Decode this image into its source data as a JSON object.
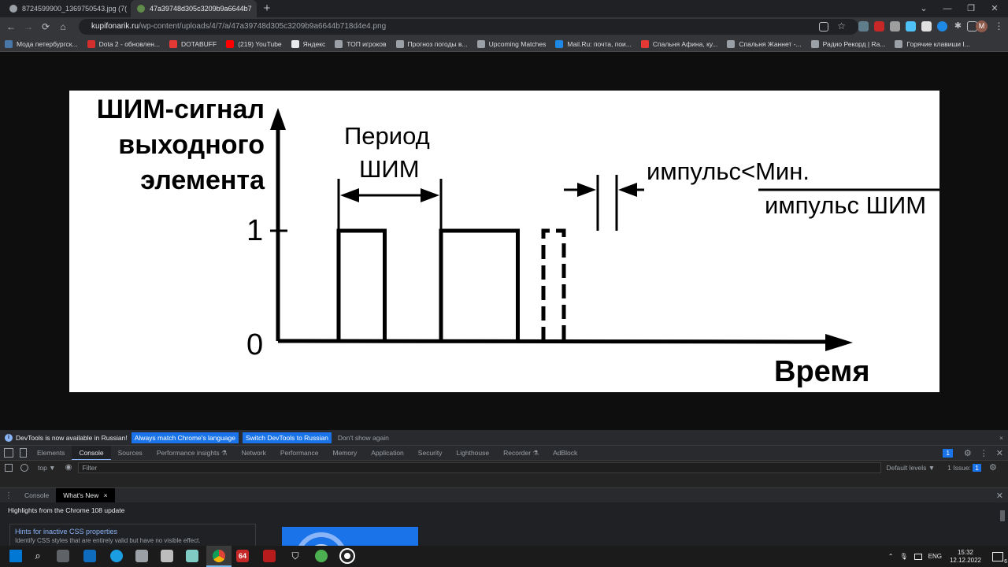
{
  "browser": {
    "tabs": [
      {
        "title": "8724599900_1369750543.jpg (7(",
        "close": "×",
        "active": false
      },
      {
        "title": "47a39748d305c3209b9a6644b7",
        "close": "×",
        "active": true
      }
    ],
    "new_tab": "+",
    "window_controls": [
      "⌄",
      "—",
      "❐",
      "✕"
    ],
    "nav": {
      "back": "←",
      "forward": "→",
      "reload": "⟳",
      "home": "⌂"
    },
    "url": {
      "host": "kupifonarik.ru",
      "path": "/wp-content/uploads/4/7/a/47a39748d305c3209b9a6644b718d4e4.png"
    },
    "profile_initial": "M",
    "bookmarks": [
      {
        "label": "Мода петербургск...",
        "color": "#4a76a8"
      },
      {
        "label": "Dota 2 - обновлен...",
        "color": "#d32f2f"
      },
      {
        "label": "DOTABUFF",
        "color": "#e53935"
      },
      {
        "label": "(219) YouTube",
        "color": "#ff0000"
      },
      {
        "label": "Яндекс",
        "color": "#e8eaed"
      },
      {
        "label": "ТОП игроков",
        "color": "#9aa0a6"
      },
      {
        "label": "Прогноз погоды в...",
        "color": "#9aa0a6"
      },
      {
        "label": "Upcoming Matches",
        "color": "#9aa0a6"
      },
      {
        "label": "Mail.Ru: почта, пои...",
        "color": "#1e88e5"
      },
      {
        "label": "Спальня Афина, ку...",
        "color": "#e53935"
      },
      {
        "label": "Спальня Жаннет -...",
        "color": "#9aa0a6"
      },
      {
        "label": "Радио Рекорд | Ra...",
        "color": "#9aa0a6"
      },
      {
        "label": "Горячие клавиши I...",
        "color": "#9aa0a6"
      }
    ]
  },
  "figure": {
    "y_label_lines": [
      "ШИМ-сигнал",
      "выходного",
      "элемента"
    ],
    "x_label": "Время",
    "tick_one": "1",
    "tick_zero": "0",
    "period_label_lines": [
      "Период",
      "ШИМ"
    ],
    "pulse_note_lines": [
      "импульс<Мин.",
      "импульс ШИМ"
    ],
    "pulses": [
      {
        "start": 1.0,
        "end": 1.45,
        "style": "solid"
      },
      {
        "start": 2.0,
        "end": 2.75,
        "style": "solid"
      },
      {
        "start": 3.0,
        "end": 3.2,
        "style": "dashed"
      }
    ],
    "period_bracket": [
      1.0,
      2.0
    ]
  },
  "devtools": {
    "infobar": {
      "message": "DevTools is now available in Russian!",
      "btn_match": "Always match Chrome's language",
      "btn_switch": "Switch DevTools to Russian",
      "dont_show": "Don't show again",
      "close": "×"
    },
    "tabs": [
      "Elements",
      "Console",
      "Sources",
      "Performance insights ⚗",
      "Network",
      "Performance",
      "Memory",
      "Application",
      "Security",
      "Lighthouse",
      "Recorder ⚗",
      "AdBlock"
    ],
    "active_tab": "Console",
    "messages_badge": "1",
    "console": {
      "context": "top ▼",
      "filter_placeholder": "Filter",
      "levels": "Default levels ▼",
      "issues": "1 Issue: ",
      "issues_count": "1"
    },
    "drawer_tabs": [
      "Console",
      "What's New"
    ],
    "drawer_active": "What's New",
    "drawer_close": "×",
    "whats_new": {
      "title": "Highlights from the Chrome 108 update",
      "hint_title": "Hints for inactive CSS properties",
      "hint_sub": "Identify CSS styles that are entirely valid but have no visible effect."
    }
  },
  "taskbar": {
    "lang": "ENG",
    "time": "15:32",
    "date": "12.12.2022",
    "notif_count": "6",
    "badge_64": "64"
  }
}
